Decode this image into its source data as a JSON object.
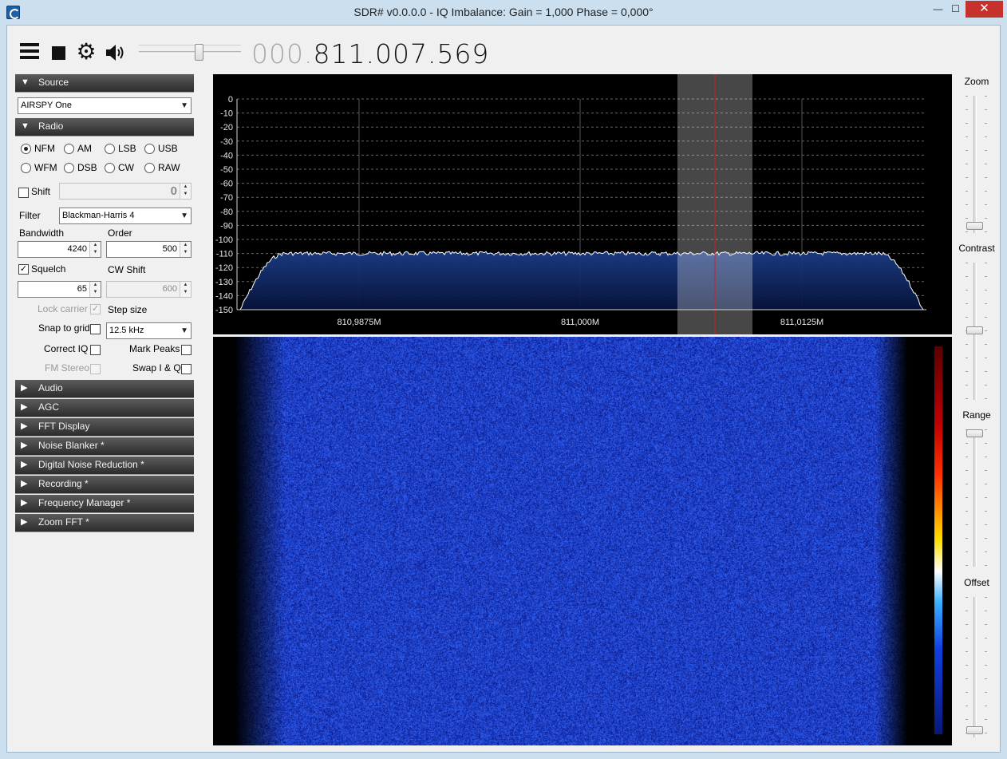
{
  "window": {
    "title": "SDR# v0.0.0.0 - IQ Imbalance: Gain = 1,000 Phase = 0,000°",
    "minimize_glyph": "—",
    "maximize_glyph": "☐",
    "close_glyph": "✕"
  },
  "toolbar": {
    "frequency_prefix": "000.",
    "frequency_main": "811.007.569",
    "volume_level": 0.6
  },
  "source": {
    "header": "Source",
    "device": "AIRSPY One"
  },
  "radio": {
    "header": "Radio",
    "modes": [
      "NFM",
      "AM",
      "LSB",
      "USB",
      "WFM",
      "DSB",
      "CW",
      "RAW"
    ],
    "selected_mode": "NFM",
    "shift_label": "Shift",
    "shift_value": "0",
    "filter_label": "Filter",
    "filter_value": "Blackman-Harris 4",
    "bandwidth_label": "Bandwidth",
    "bandwidth_value": "4240",
    "order_label": "Order",
    "order_value": "500",
    "squelch_label": "Squelch",
    "squelch_value": "65",
    "cw_shift_label": "CW Shift",
    "cw_shift_value": "600",
    "lock_carrier_label": "Lock carrier",
    "step_size_label": "Step size",
    "snap_to_grid_label": "Snap to grid",
    "step_size_value": "12.5 kHz",
    "correct_iq_label": "Correct IQ",
    "mark_peaks_label": "Mark Peaks",
    "fm_stereo_label": "FM Stereo",
    "swap_iq_label": "Swap I & Q",
    "check_glyph": "✓"
  },
  "collapsed_sections": [
    "Audio",
    "AGC",
    "FFT Display",
    "Noise Blanker *",
    "Digital Noise Reduction *",
    "Recording *",
    "Frequency Manager *",
    "Zoom FFT *"
  ],
  "spectrum": {
    "y_ticks": [
      "0",
      "-10",
      "-20",
      "-30",
      "-40",
      "-50",
      "-60",
      "-70",
      "-80",
      "-90",
      "-100",
      "-110",
      "-120",
      "-130",
      "-140",
      "-150"
    ],
    "x_ticks": [
      "810,9875M",
      "811,000M",
      "811,0125M"
    ],
    "noise_floor_db": -110,
    "trace_color": "#ffffff",
    "fill_color": "#0a2a6a",
    "tuning_line_color": "#cc2222"
  },
  "right_panel": {
    "zoom_label": "Zoom",
    "contrast_label": "Contrast",
    "range_label": "Range",
    "offset_label": "Offset"
  },
  "waterfall": {
    "base_color": "#1a3fbf"
  }
}
